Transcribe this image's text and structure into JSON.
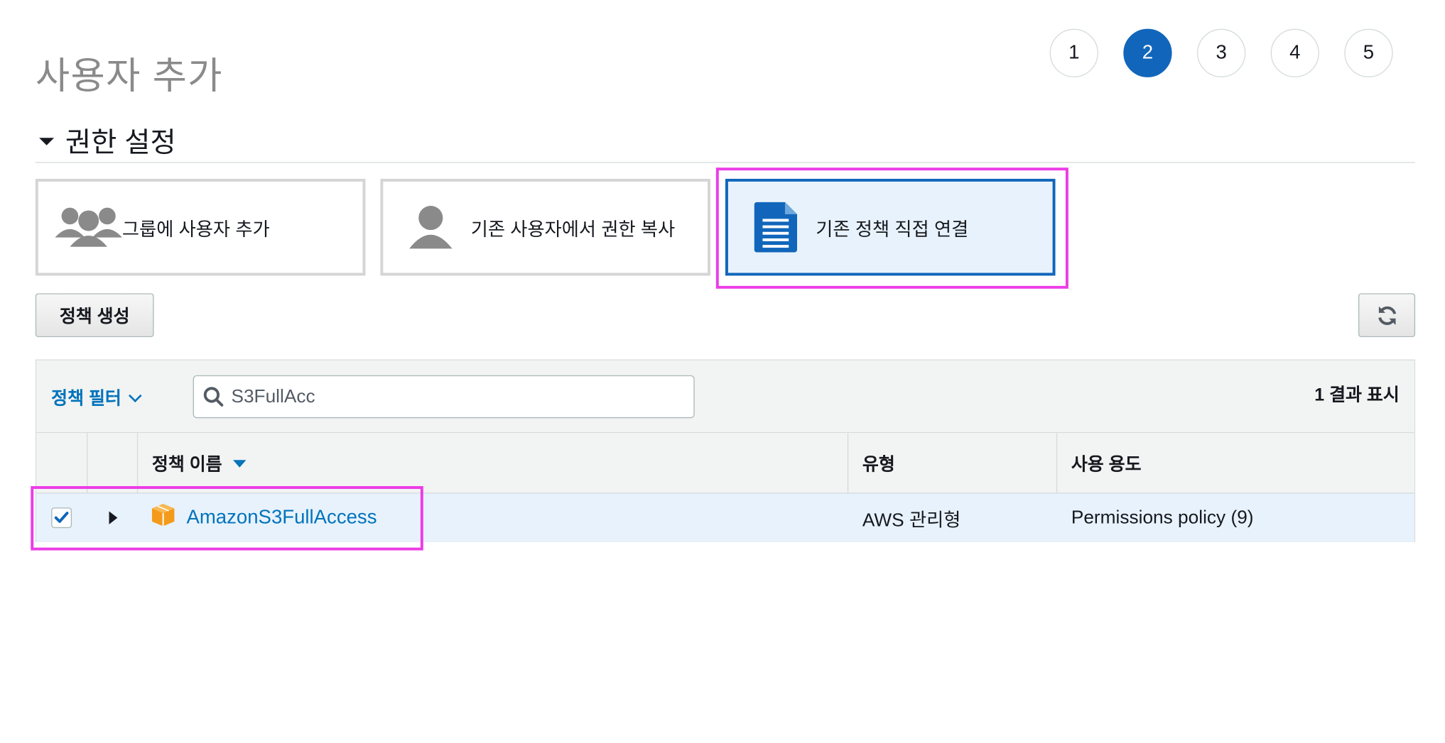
{
  "header": {
    "title": "사용자 추가",
    "steps": [
      "1",
      "2",
      "3",
      "4",
      "5"
    ],
    "active_step": "2"
  },
  "permissions": {
    "section_title": "권한 설정",
    "options": [
      {
        "label": "그룹에 사용자 추가",
        "icon": "group-users-icon"
      },
      {
        "label": "기존 사용자에서 권한 복사",
        "icon": "user-icon"
      },
      {
        "label": "기존 정책 직접 연결",
        "icon": "document-icon",
        "selected": true
      }
    ],
    "create_policy_label": "정책 생성",
    "refresh_icon": "refresh-icon"
  },
  "policy_table": {
    "filter_label": "정책 필터",
    "search": {
      "value": "S3FullAcc"
    },
    "result_count": "1 결과 표시",
    "columns": {
      "name": "정책 이름",
      "type": "유형",
      "usage": "사용 용도"
    },
    "rows": [
      {
        "checked": true,
        "name": "AmazonS3FullAccess",
        "type": "AWS 관리형",
        "usage": "Permissions policy (9)",
        "icon": "aws-managed-box-icon"
      }
    ]
  },
  "colors": {
    "accent": "#1166bb",
    "link": "#0073bb",
    "highlight": "#ec3ce6",
    "selected_bg": "#e8f2fc",
    "policy_icon": "#f49a1a"
  }
}
